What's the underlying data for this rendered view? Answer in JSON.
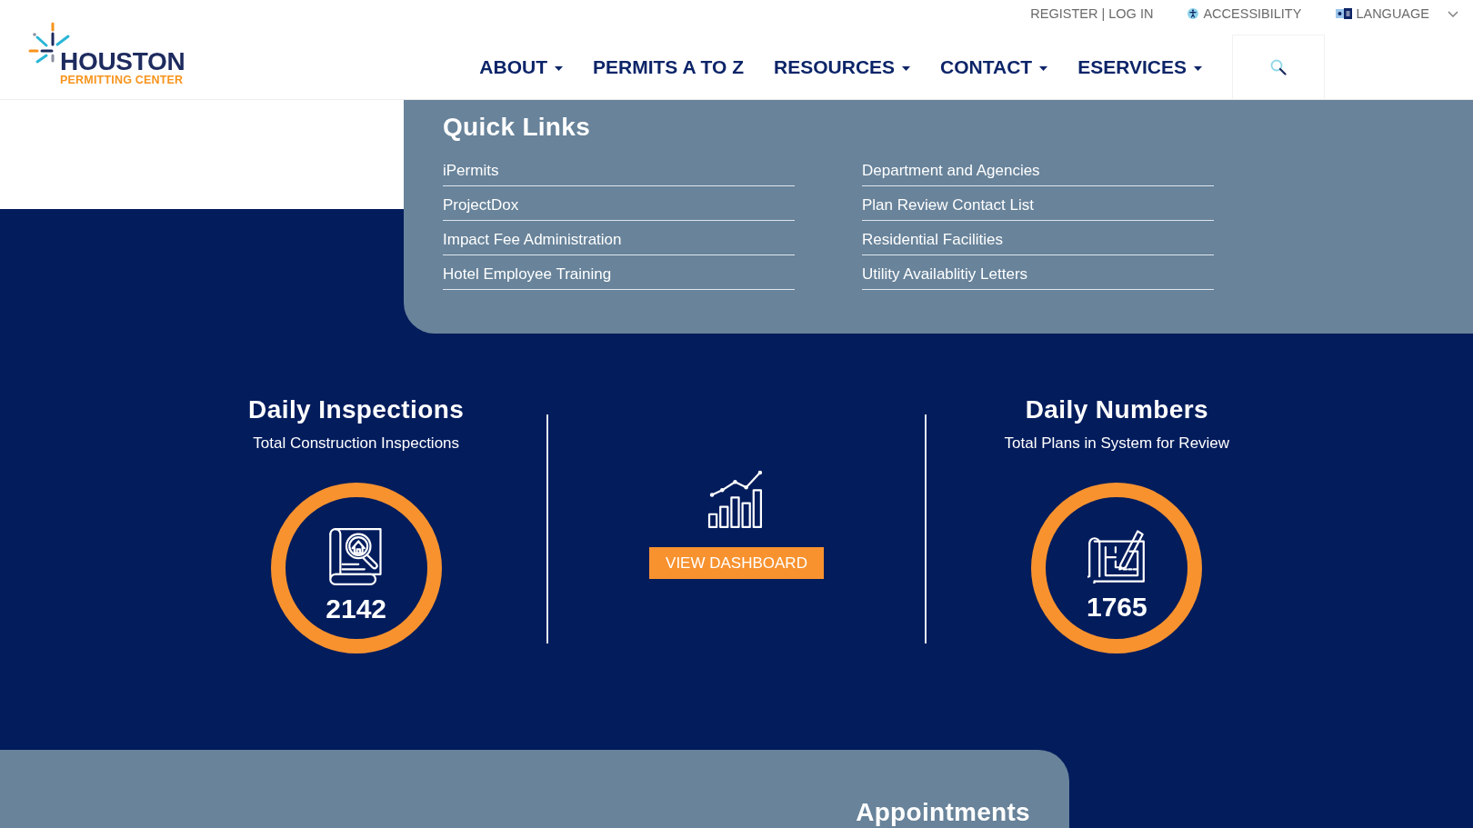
{
  "header": {
    "logo": {
      "wordmark": "HOUSTON",
      "tagline": "PERMITTING CENTER"
    },
    "utility": {
      "register": "REGISTER",
      "separator": "|",
      "login": "LOG IN",
      "accessibility": "ACCESSIBILITY",
      "language": "LANGUAGE"
    },
    "nav": [
      {
        "label": "ABOUT",
        "has_menu": true
      },
      {
        "label": "PERMITS A TO Z",
        "has_menu": false
      },
      {
        "label": "RESOURCES",
        "has_menu": true
      },
      {
        "label": "CONTACT",
        "has_menu": true
      },
      {
        "label": "ESERVICES",
        "has_menu": true
      }
    ]
  },
  "quick_links": {
    "title": "Quick Links",
    "columns": [
      [
        "iPermits",
        "ProjectDox",
        "Impact Fee Administration",
        "Hotel Employee Training"
      ],
      [
        "Department and Agencies",
        "Plan Review Contact List",
        "Residential Facilities",
        "Utility Availablitiy Letters"
      ]
    ]
  },
  "stats": {
    "inspections": {
      "title": "Daily Inspections",
      "subtitle": "Total Construction Inspections",
      "count": "2142"
    },
    "dashboard": {
      "button": "VIEW DASHBOARD"
    },
    "plans": {
      "title": "Daily Numbers",
      "subtitle": "Total Plans in System for Review",
      "count": "1765"
    }
  },
  "appointments": {
    "title": "Appointments"
  }
}
